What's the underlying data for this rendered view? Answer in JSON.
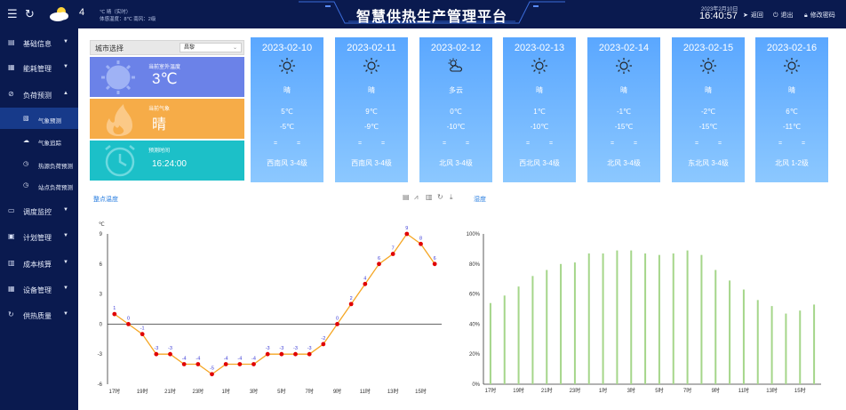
{
  "header": {
    "menu_icon": "menu-icon",
    "refresh_icon": "refresh-icon",
    "weather_icon": "cloud-sun-icon",
    "temp_num": "4",
    "weather_realtime": "℃ 晴（实时）",
    "weather_detail": "体感温度：8℃ 南风：2级",
    "title": "智慧供热生产管理平台",
    "date": "2023年2月10日",
    "time": "16:40:57",
    "back_label": "返回",
    "logout_label": "退出",
    "change_pwd_label": "修改密码"
  },
  "sidebar": {
    "items": [
      {
        "label": "基础信息",
        "icon": "database-icon"
      },
      {
        "label": "能耗管理",
        "icon": "document-icon"
      },
      {
        "label": "负荷预测",
        "icon": "circle-check-icon"
      },
      {
        "label": "调度监控",
        "icon": "monitor-icon"
      },
      {
        "label": "计划管理",
        "icon": "calendar-icon"
      },
      {
        "label": "成本核算",
        "icon": "file-icon"
      },
      {
        "label": "设备管理",
        "icon": "grid-icon"
      },
      {
        "label": "供热质量",
        "icon": "refresh-circle-icon"
      }
    ],
    "sub_items": [
      {
        "label": "气象预测"
      },
      {
        "label": "气象追踪"
      },
      {
        "label": "热源负荷预测"
      },
      {
        "label": "站点负荷预测"
      }
    ]
  },
  "panel": {
    "city_label": "城市选择",
    "city_value": "昌黎",
    "temp_label": "当前室外温度",
    "temp_value": "3℃",
    "weather_label": "当前气象",
    "weather_value": "晴",
    "time_label": "预测时间",
    "time_value": "16:24:00"
  },
  "forecast": [
    {
      "date": "2023-02-10",
      "icon": "sun-icon",
      "desc": "晴",
      "hi": "5℃",
      "lo": "-5℃",
      "wind": "西南风 3-4级"
    },
    {
      "date": "2023-02-11",
      "icon": "sun-icon",
      "desc": "晴",
      "hi": "9℃",
      "lo": "-9℃",
      "wind": "西南风 3-4级"
    },
    {
      "date": "2023-02-12",
      "icon": "cloud-sun-icon",
      "desc": "多云",
      "hi": "0℃",
      "lo": "-10℃",
      "wind": "北风  3-4级"
    },
    {
      "date": "2023-02-13",
      "icon": "sun-icon",
      "desc": "晴",
      "hi": "1℃",
      "lo": "-10℃",
      "wind": "西北风 3-4级"
    },
    {
      "date": "2023-02-14",
      "icon": "sun-icon",
      "desc": "晴",
      "hi": "-1℃",
      "lo": "-15℃",
      "wind": "北风  3-4级"
    },
    {
      "date": "2023-02-15",
      "icon": "sun-icon",
      "desc": "晴",
      "hi": "-2℃",
      "lo": "-15℃",
      "wind": "东北风 3-4级"
    },
    {
      "date": "2023-02-16",
      "icon": "sun-icon",
      "desc": "晴",
      "hi": "6℃",
      "lo": "-11℃",
      "wind": "北风  1-2级"
    }
  ],
  "charts": {
    "temp_link": "整点温度",
    "humidity_link": "湿度",
    "tools": [
      "data-view-icon",
      "line-switch-icon",
      "bar-switch-icon",
      "restore-icon",
      "download-icon"
    ]
  },
  "chart_data": [
    {
      "type": "line",
      "title": "",
      "ylabel": "℃",
      "x": [
        "17时",
        "18时",
        "19时",
        "20时",
        "21时",
        "22时",
        "23时",
        "0时",
        "1时",
        "2时",
        "3时",
        "4时",
        "5时",
        "6时",
        "7时",
        "8时",
        "9时",
        "10时",
        "11时",
        "12时",
        "13时",
        "14时",
        "15时",
        "16时"
      ],
      "xticks": [
        "17时",
        "19时",
        "21时",
        "23时",
        "1时",
        "3时",
        "5时",
        "7时",
        "9时",
        "11时",
        "13时",
        "15时"
      ],
      "values": [
        1,
        0,
        -1,
        -3,
        -3,
        -4,
        -4,
        -5,
        -4,
        -4,
        -4,
        -3,
        -3,
        -3,
        -3,
        -2,
        0,
        2,
        4,
        6,
        7,
        9,
        8,
        6
      ],
      "ylim": [
        -6,
        9
      ],
      "yticks": [
        9,
        6,
        3,
        0,
        -3,
        -6
      ],
      "line_color": "#f5a623",
      "point_color": "#e00000",
      "label_color": "#3a3ad6"
    },
    {
      "type": "bar",
      "title": "",
      "x": [
        "17时",
        "18时",
        "19时",
        "20时",
        "21时",
        "22时",
        "23时",
        "0时",
        "1时",
        "2时",
        "3时",
        "4时",
        "5时",
        "6时",
        "7时",
        "8时",
        "9时",
        "10时",
        "11时",
        "12时",
        "13时",
        "14时",
        "15时",
        "16时"
      ],
      "xticks": [
        "17时",
        "19时",
        "21时",
        "23时",
        "1时",
        "3时",
        "5时",
        "7时",
        "9时",
        "11时",
        "13时",
        "15时"
      ],
      "values": [
        54,
        59,
        65,
        72,
        76,
        80,
        81,
        87,
        87,
        89,
        89,
        87,
        86,
        87,
        89,
        86,
        76,
        69,
        63,
        56,
        52,
        47,
        49,
        53
      ],
      "ylim": [
        0,
        100
      ],
      "yticks": [
        "100%",
        "80%",
        "60%",
        "40%",
        "20%",
        "0%"
      ],
      "bar_color": "#a5d68a"
    }
  ]
}
